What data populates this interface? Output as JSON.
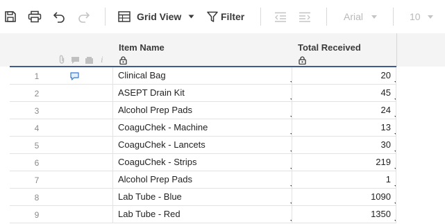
{
  "toolbar": {
    "view_label": "Grid View",
    "filter_label": "Filter",
    "font_name": "Arial",
    "font_size": "10",
    "icons": [
      "save-icon",
      "print-icon",
      "undo-icon",
      "redo-icon",
      "grid-icon",
      "chevron-down-icon",
      "filter-icon",
      "outdent-icon",
      "indent-icon"
    ]
  },
  "columns": [
    {
      "title": "Item Name",
      "locked": true
    },
    {
      "title": "Total Received",
      "locked": true
    }
  ],
  "header_icons": [
    "attachment-icon",
    "comment-icon",
    "proof-icon",
    "info-icon"
  ],
  "rows": [
    {
      "num": "1",
      "name": "Clinical Bag",
      "total": "20",
      "has_comment": true
    },
    {
      "num": "2",
      "name": "ASEPT Drain Kit",
      "total": "45",
      "has_comment": false
    },
    {
      "num": "3",
      "name": "Alcohol Prep Pads",
      "total": "24",
      "has_comment": false
    },
    {
      "num": "4",
      "name": "CoaguChek - Machine",
      "total": "13",
      "has_comment": false
    },
    {
      "num": "5",
      "name": "CoaguChek - Lancets",
      "total": "30",
      "has_comment": false
    },
    {
      "num": "6",
      "name": "CoaguChek - Strips",
      "total": "219",
      "has_comment": false
    },
    {
      "num": "7",
      "name": "Alcohol Prep Pads",
      "total": "1",
      "has_comment": false
    },
    {
      "num": "8",
      "name": "Lab Tube - Blue",
      "total": "1090",
      "has_comment": false
    },
    {
      "num": "9",
      "name": "Lab Tube - Red",
      "total": "1350",
      "has_comment": false
    }
  ],
  "colors": {
    "accent": "#3e5a8f",
    "comment": "#2f7bd6",
    "header_bg": "#f4f4f4"
  }
}
